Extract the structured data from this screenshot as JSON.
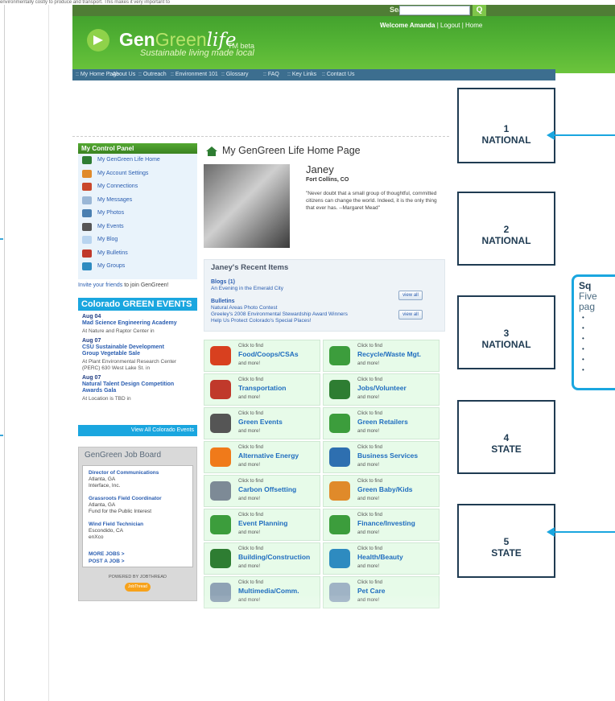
{
  "page": {
    "top_strip_text": "environmentally costly to produce and transport. This makes it very important to"
  },
  "header": {
    "search_label": "Search:",
    "search_value": "",
    "search_button": "Q",
    "welcome_prefix": "Welcome Amanda",
    "welcome_links": "| Logout | Home",
    "logo_gen": "Gen",
    "logo_green": "Green",
    "logo_life": "life",
    "logo_beta": "TM beta",
    "tagline": "Sustainable living made local"
  },
  "nav": {
    "items": [
      ":: My Home Page",
      ":: About Us",
      ":: Outreach",
      ":: Environment 101",
      ":: Glossary",
      ":: FAQ",
      ":: Key Links",
      ":: Contact Us"
    ]
  },
  "control_panel": {
    "title": "My Control Panel",
    "items": [
      {
        "label": "My GenGreen Life Home",
        "icon": "home-icon",
        "color": "#2e7d32"
      },
      {
        "label": "My Account Settings",
        "icon": "tools-icon",
        "color": "#e08a2a"
      },
      {
        "label": "My Connections",
        "icon": "people-icon",
        "color": "#c9472b"
      },
      {
        "label": "My Messages",
        "icon": "envelope-icon",
        "color": "#9ab7d6"
      },
      {
        "label": "My Photos",
        "icon": "photos-icon",
        "color": "#4a7fb0"
      },
      {
        "label": "My Events",
        "icon": "calendar-icon",
        "color": "#555555"
      },
      {
        "label": "My Blog",
        "icon": "speech-bubble-icon",
        "color": "#b8d4ef"
      },
      {
        "label": "My Bulletins",
        "icon": "pushpin-icon",
        "color": "#c0392b"
      },
      {
        "label": "My Groups",
        "icon": "groups-icon",
        "color": "#2e8bc0"
      }
    ],
    "invite_link": "Invite your friends",
    "invite_text": "to join GenGreen!"
  },
  "events": {
    "title": "Colorado GREEN EVENTS",
    "items": [
      {
        "date": "Aug 04",
        "title": "Mad Science Engineering Academy",
        "location": "At Nature and Raptor Center in"
      },
      {
        "date": "Aug 07",
        "title": "CSU Sustainable Development\nGroup Vegetable Sale",
        "location": "At Plant Environmental Research Center\n(PERC) 630 West Lake St. in"
      },
      {
        "date": "Aug 07",
        "title": "Natural Talent Design Competition\nAwards Gala",
        "location": "At Location is TBD in"
      }
    ],
    "view_all": "View All Colorado Events"
  },
  "job_board": {
    "title": "GenGreen Job Board",
    "jobs": [
      {
        "title": "Director of Communications",
        "place": "Atlanta, GA",
        "org": "Interface, Inc."
      },
      {
        "title": "Grassroots Field Coordinator",
        "place": "Atlanta, GA",
        "org": "Fund for the Public Interest"
      },
      {
        "title": "Wind Field Technician",
        "place": "Escondido, CA",
        "org": "enXco"
      }
    ],
    "more_jobs": "MORE JOBS >",
    "post_job": "POST A JOB >",
    "powered_by": "POWERED BY JOBTHREAD",
    "badge": "JobThread"
  },
  "profile": {
    "page_title": "My GenGreen Life Home Page",
    "name": "Janey",
    "location": "Fort Collins, CO",
    "quote": "\"Never doubt that a small group of thoughtful, committed citizens can change the world. Indeed, it is the only thing that ever has. --Margaret Mead\""
  },
  "recent": {
    "title": "Janey's Recent Items",
    "blogs_head": "Blogs (1)",
    "blogs": [
      "An Evening in the Emerald City"
    ],
    "bulletins_head": "Bulletins",
    "bulletins": [
      "Natural Areas Photo Contest",
      "Greeley's 2008 Environmental Stewardship Award Winners",
      "Help Us Protect Colorado's Special Places!"
    ],
    "view_all": "view all"
  },
  "tiles": {
    "small_text": "Click to find",
    "more_text": "and more!",
    "items": [
      {
        "label": "Food/Coops/CSAs",
        "icon": "tomato-icon",
        "color": "#d8401f"
      },
      {
        "label": "Recycle/Waste Mgt.",
        "icon": "recycle-icon",
        "color": "#3c9d3c"
      },
      {
        "label": "Transportation",
        "icon": "bus-icon",
        "color": "#c0392b"
      },
      {
        "label": "Jobs/Volunteer",
        "icon": "briefcase-icon",
        "color": "#2e7d32"
      },
      {
        "label": "Green Events",
        "icon": "calendar-icon",
        "color": "#555555"
      },
      {
        "label": "Green Retailers",
        "icon": "storefront-icon",
        "color": "#3c9d3c"
      },
      {
        "label": "Alternative Energy",
        "icon": "sun-icon",
        "color": "#f07a1a"
      },
      {
        "label": "Business Services",
        "icon": "business-person-icon",
        "color": "#2e6fb0"
      },
      {
        "label": "Carbon Offsetting",
        "icon": "co2-cloud-icon",
        "color": "#7d8a96"
      },
      {
        "label": "Green Baby/Kids",
        "icon": "kids-icon",
        "color": "#e08a2a"
      },
      {
        "label": "Event Planning",
        "icon": "clipboard-icon",
        "color": "#3c9d3c"
      },
      {
        "label": "Finance/Investing",
        "icon": "calculator-icon",
        "color": "#3c9d3c"
      },
      {
        "label": "Building/Construction",
        "icon": "hammer-icon",
        "color": "#2e7d32"
      },
      {
        "label": "Health/Beauty",
        "icon": "water-drop-icon",
        "color": "#2e8bc0"
      },
      {
        "label": "Multimedia/Comm.",
        "icon": "monitor-icon",
        "color": "#8fa3b5"
      },
      {
        "label": "Pet Care",
        "icon": "pet-icon",
        "color": "#9fb3c5"
      }
    ]
  },
  "annotations": {
    "boxes": [
      {
        "num": "1",
        "label": "NATIONAL"
      },
      {
        "num": "2",
        "label": "NATIONAL"
      },
      {
        "num": "3",
        "label": "NATIONAL"
      },
      {
        "num": "4",
        "label": "STATE"
      },
      {
        "num": "5",
        "label": "STATE"
      }
    ],
    "callout_title": "Sq",
    "callout_lines": [
      "Five",
      "pag"
    ]
  }
}
